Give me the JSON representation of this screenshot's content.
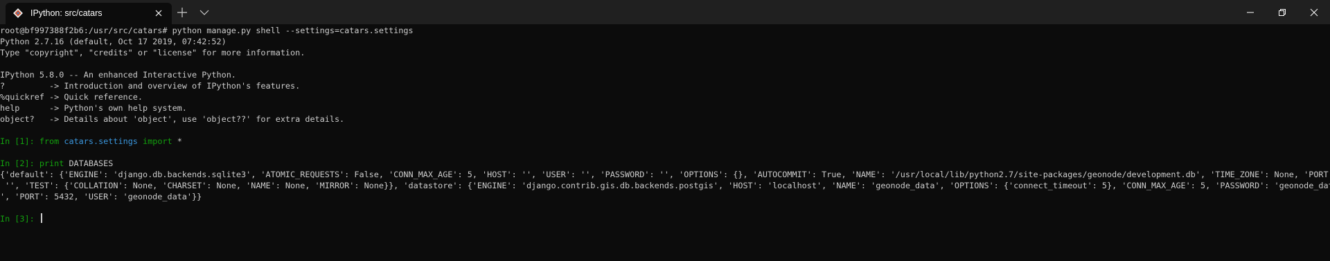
{
  "window": {
    "tab_title": "IPython: src/catars",
    "colors": {
      "titlebar_bg": "#202020",
      "terminal_bg": "#0c0c0c",
      "text": "#cccccc",
      "prompt_green": "#13a10e",
      "module_blue": "#3a96dd"
    },
    "icons": {
      "tab_app": "ipython-logo-icon",
      "tab_close": "close-icon",
      "new_tab": "plus-icon",
      "tab_dropdown": "chevron-down-icon",
      "minimize": "minimize-icon",
      "maximize": "maximize-icon",
      "close": "close-icon"
    }
  },
  "terminal": {
    "shell_command": "root@bf997388f2b6:/usr/src/catars# python manage.py shell --settings=catars.settings",
    "python_version": "Python 2.7.16 (default, Oct 17 2019, 07:42:52)",
    "type_hint": "Type \"copyright\", \"credits\" or \"license\" for more information.",
    "ipython_version": "IPython 5.8.0 -- An enhanced Interactive Python.",
    "help_lines": [
      "?         -> Introduction and overview of IPython's features.",
      "%quickref -> Quick reference.",
      "help      -> Python's own help system.",
      "object?   -> Details about 'object', use 'object??' for extra details."
    ],
    "in1": {
      "prompt": "In [1]: ",
      "kw_from": "from",
      "module": "catars.settings",
      "kw_import": "import",
      "rest": " *"
    },
    "in2": {
      "prompt": "In [2]: ",
      "kw_print": "print",
      "rest": " DATABASES"
    },
    "output_lines": [
      "{'default': {'ENGINE': 'django.db.backends.sqlite3', 'ATOMIC_REQUESTS': False, 'CONN_MAX_AGE': 5, 'HOST': '', 'USER': '', 'PASSWORD': '', 'OPTIONS': {}, 'AUTOCOMMIT': True, 'NAME': '/usr/local/lib/python2.7/site-packages/geonode/development.db', 'TIME_ZONE': None, 'PORT':",
      " '', 'TEST': {'COLLATION': None, 'CHARSET': None, 'NAME': None, 'MIRROR': None}}, 'datastore': {'ENGINE': 'django.contrib.gis.db.backends.postgis', 'HOST': 'localhost', 'NAME': 'geonode_data', 'OPTIONS': {'connect_timeout': 5}, 'CONN_MAX_AGE': 5, 'PASSWORD': 'geonode_data",
      "', 'PORT': 5432, 'USER': 'geonode_data'}}"
    ],
    "in3": {
      "prompt": "In [3]: "
    }
  }
}
